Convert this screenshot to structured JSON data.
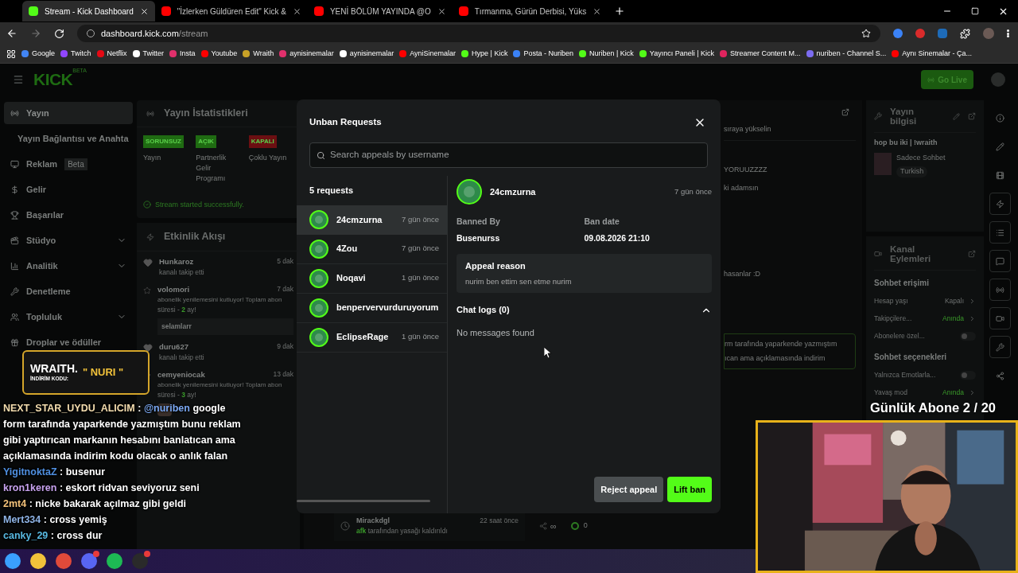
{
  "browser": {
    "tabs": [
      {
        "title": "Stream - Kick Dashboard",
        "color": "#53fc18",
        "selected": true
      },
      {
        "title": "\"İzlerken Güldüren Edit\" Kick &",
        "color": "#ff0000",
        "selected": false
      },
      {
        "title": "YENİ BÖLÜM YAYINDA @O",
        "color": "#ff0000",
        "selected": false
      },
      {
        "title": "Tırmanma, Gürün Derbisi, Yüks",
        "color": "#ff0000",
        "selected": false
      }
    ],
    "address": {
      "host": "dashboard.kick.com",
      "path": "/stream"
    },
    "bookmarks": [
      {
        "label": "Google",
        "color": "#4285f4"
      },
      {
        "label": "Twitch",
        "color": "#9146ff"
      },
      {
        "label": "Netflix",
        "color": "#e50914"
      },
      {
        "label": "Twitter",
        "color": "#ffffff"
      },
      {
        "label": "Insta",
        "color": "#e1306c"
      },
      {
        "label": "Youtube",
        "color": "#ff0000"
      },
      {
        "label": "Wraith",
        "color": "#c9a227"
      },
      {
        "label": "aynisinemalar",
        "color": "#e1306c"
      },
      {
        "label": "aynisinemalar",
        "color": "#ffffff"
      },
      {
        "label": "AyniSinemalar",
        "color": "#ff0000"
      },
      {
        "label": "Hype | Kick",
        "color": "#53fc18"
      },
      {
        "label": "Posta - Nuriben",
        "color": "#3b82f6"
      },
      {
        "label": "Nuriben | Kick",
        "color": "#53fc18"
      },
      {
        "label": "Yayıncı Paneli | Kick",
        "color": "#53fc18"
      },
      {
        "label": "Streamer Content M...",
        "color": "#e0245e"
      },
      {
        "label": "nuriben - Channel S...",
        "color": "#7c6cf0"
      },
      {
        "label": "Aynı Sinemalar - Ça...",
        "color": "#ff0000"
      }
    ]
  },
  "header": {
    "logo": "KICK",
    "logo_tag": "BETA",
    "go_live": "Go Live"
  },
  "sidebar": {
    "items": [
      {
        "label": "Yayın",
        "kind": "broadcast",
        "selected": true
      },
      {
        "label": "Yayın Bağlantısı ve Anahta",
        "kind": "link",
        "selected": false
      },
      {
        "label": "Reklam",
        "badge": "Beta",
        "kind": "ad",
        "selected": false
      },
      {
        "label": "Gelir",
        "kind": "money",
        "selected": false
      },
      {
        "label": "Başarılar",
        "kind": "trophy",
        "selected": false
      },
      {
        "label": "Stüdyo",
        "kind": "studio",
        "expandable": true,
        "selected": false
      },
      {
        "label": "Analitik",
        "kind": "chart",
        "expandable": true,
        "selected": false
      },
      {
        "label": "Denetleme",
        "kind": "wrench",
        "selected": false
      },
      {
        "label": "Topluluk",
        "kind": "people",
        "expandable": true,
        "selected": false
      },
      {
        "label": "Droplar ve ödüller",
        "kind": "gift",
        "selected": false
      }
    ]
  },
  "stats": {
    "title": "Yayın İstatistikleri",
    "items": [
      {
        "badge": "SORUNSUZ",
        "color": "#1f6b12",
        "label": "Yayın"
      },
      {
        "badge": "AÇIK",
        "color": "#1f6b12",
        "label": "Partnerlik Gelir Programı"
      },
      {
        "badge": "KAPALI",
        "color": "#6b0f12",
        "label": "Çoklu Yayın"
      }
    ],
    "status": "Stream started successfully."
  },
  "activity": {
    "title": "Etkinlik Akışı",
    "events": [
      {
        "kind": "follow",
        "user": "Hunkaroz",
        "time": "5 dak",
        "detail": "kanalı takip etti"
      },
      {
        "kind": "sub",
        "user": "volomori",
        "time": "7 dak",
        "detail": "abonelik yenilemesini kutluyor! Toplam abon",
        "prefix": "süresi - ",
        "months": "2",
        "suffix": " ay!",
        "message": "selamlarr"
      },
      {
        "kind": "follow",
        "user": "duru627",
        "time": "9 dak",
        "detail": "kanalı takip etti"
      },
      {
        "kind": "sub",
        "user": "cemyeniocak",
        "time": "13 dak",
        "detail": "abonelik yenilemesini kutluyor! Toplam abon",
        "prefix": "süresi - ",
        "months": "3",
        "suffix": " ay!",
        "emote": true
      }
    ]
  },
  "chat_panel": {
    "lines": [
      "sıraya yükselin",
      "YORUUZZZZ",
      "ki adamsın",
      "hasanlar :D"
    ],
    "highlight": [
      "rm tarafında yaparkende yazmıştım",
      "ıcan ama açıklamasında indirim"
    ]
  },
  "moderation_row": {
    "user": "Mirackdgl",
    "time": "22 saat önce",
    "actor": "afk",
    "detail": "tarafından yasağı kaldırıldı",
    "limit": "∞",
    "count": "0"
  },
  "stream_info": {
    "title": "Yayın bilgisi",
    "stream_title": "hop bu iki | !wraith",
    "category": "Sadece Sohbet",
    "tag": "Turkish"
  },
  "channel_actions": {
    "title": "Kanal Eylemleri",
    "sections": [
      {
        "heading": "Sohbet erişimi",
        "rows": [
          {
            "kind": "select",
            "label": "Hesap yaşı",
            "value": "Kapalı",
            "active": false
          },
          {
            "kind": "select",
            "label": "Takipçilere...",
            "value": "Anında",
            "active": true
          },
          {
            "kind": "toggle",
            "label": "Abonelere özel...",
            "on": false
          }
        ]
      },
      {
        "heading": "Sohbet seçenekleri",
        "rows": [
          {
            "kind": "toggle",
            "label": "Yalnızca Emotlarla...",
            "on": false
          },
          {
            "kind": "select",
            "label": "Yavaş mod",
            "value": "Anında",
            "active": true
          }
        ]
      }
    ]
  },
  "side_strip": [
    {
      "kind": "info",
      "boxed": false
    },
    {
      "kind": "pencil",
      "boxed": false
    },
    {
      "kind": "film",
      "boxed": false
    },
    {
      "kind": "bolt",
      "boxed": true
    },
    {
      "kind": "list",
      "boxed": true
    },
    {
      "kind": "chat",
      "boxed": true
    },
    {
      "kind": "broadcast",
      "boxed": true
    },
    {
      "kind": "camera",
      "boxed": true
    },
    {
      "kind": "wrench",
      "boxed": true
    },
    {
      "kind": "dots",
      "boxed": false
    }
  ],
  "modal": {
    "title": "Unban Requests",
    "search": {
      "placeholder": "Search appeals by username"
    },
    "count": "5 requests",
    "requests": [
      {
        "user": "24cmzurna",
        "time": "7 gün önce",
        "selected": true
      },
      {
        "user": "4Zou",
        "time": "7 gün önce",
        "selected": false
      },
      {
        "user": "Noqavi",
        "time": "1 gün önce",
        "selected": false
      },
      {
        "user": "benpervervurduruyorum",
        "selected": false
      },
      {
        "user": "EclipseRage",
        "time": "1 gün önce",
        "selected": false
      }
    ],
    "detail": {
      "user": "24cmzurna",
      "time": "7 gün önce",
      "banned_by_label": "Banned By",
      "banned_by": "Busenurss",
      "ban_date_label": "Ban date",
      "ban_date": "09.08.2026 21:10",
      "reason_label": "Appeal reason",
      "reason": "nurim ben ettim sen etme nurim",
      "logs_label": "Chat logs (0)",
      "logs_expanded": true,
      "logs_empty": "No messages found"
    },
    "buttons": {
      "reject": "Reject appeal",
      "lift": "Lift ban"
    }
  },
  "overlay": {
    "sponsor": {
      "brand": "WRAITH.",
      "code_label": "İNDİRİM KODU:",
      "code": "\" NURI \""
    },
    "sub_goal": "Günlük Abone 2 / 20",
    "chat": [
      {
        "user": "NEXT_STAR_UYDU_ALICIM",
        "color": "#f3dcae",
        "sep": ":",
        "mention": "@nuriben",
        "text": "google form tarafında yaparkende yazmıştım bunu reklam gibi yaptırıcan markanın hesabını banlatıcan ama açıklamasında indirim kodu olacak o anlık falan"
      },
      {
        "user": "YigitnoktaZ",
        "color": "#4f8fe0",
        "sep": ":",
        "text": "busenur"
      },
      {
        "user": "kron1keren",
        "color": "#c7a2ee",
        "sep": ":",
        "text": "eskort ridvan seviyoruz seni"
      },
      {
        "user": "2mt4",
        "color": "#f3c27a",
        "sep": ":",
        "text": "nicke bakarak açılmaz gibi geldi"
      },
      {
        "user": "Mert334",
        "color": "#8fb4e6",
        "sep": ":",
        "text": "cross yemiş"
      },
      {
        "user": "canky_29",
        "color": "#58b8e0",
        "sep": ":",
        "text": "cross dur"
      }
    ]
  },
  "taskbar": [
    {
      "kind": "windows",
      "badge": false
    },
    {
      "kind": "folder",
      "badge": false
    },
    {
      "kind": "chrome",
      "badge": false
    },
    {
      "kind": "discord",
      "badge": true
    },
    {
      "kind": "spotify",
      "badge": false
    },
    {
      "kind": "obs",
      "badge": true
    }
  ]
}
